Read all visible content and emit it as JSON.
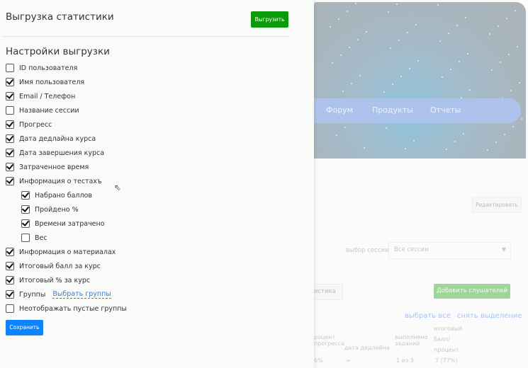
{
  "panel": {
    "title": "Выгрузка статистики",
    "export_label": "Выгрузить",
    "settings_title": "Настройки выгрузки",
    "save_label": "Сохранить",
    "options": [
      {
        "label": "ID пользователя",
        "checked": false,
        "indent": false
      },
      {
        "label": "Имя пользователя",
        "checked": true,
        "indent": false
      },
      {
        "label": "Email / Телефон",
        "checked": true,
        "indent": false
      },
      {
        "label": "Название сессии",
        "checked": false,
        "indent": false
      },
      {
        "label": "Прогресс",
        "checked": true,
        "indent": false
      },
      {
        "label": "Дата дедлайна курса",
        "checked": true,
        "indent": false
      },
      {
        "label": "Дата завершения курса",
        "checked": true,
        "indent": false
      },
      {
        "label": "Затраченное время",
        "checked": true,
        "indent": false
      },
      {
        "label": "Информация о тестахъ",
        "checked": true,
        "indent": false
      },
      {
        "label": "Набрано баллов",
        "checked": true,
        "indent": true
      },
      {
        "label": "Пройдено %",
        "checked": true,
        "indent": true
      },
      {
        "label": "Времени затрачено",
        "checked": true,
        "indent": true
      },
      {
        "label": "Вес",
        "checked": false,
        "indent": true
      },
      {
        "label": "Информация о материалах",
        "checked": true,
        "indent": false
      },
      {
        "label": "Итоговый балл за курс",
        "checked": true,
        "indent": false
      },
      {
        "label": "Итоговый % за курс",
        "checked": true,
        "indent": false
      },
      {
        "label": "Группы",
        "checked": true,
        "indent": false,
        "link": "Выбрать группы"
      },
      {
        "label": "Неотображать пустые группы",
        "checked": false,
        "indent": false
      }
    ]
  },
  "background": {
    "nav": [
      "Форум",
      "Продукты",
      "Отчеты"
    ],
    "edit_label": "Редактировать",
    "session_label": "выбор сессии",
    "session_value": "Все сессии",
    "stats_label": "тистика",
    "add_label": "Добавить слушателей",
    "select_all": "выбрать все",
    "deselect": "снять выделение",
    "headers": [
      "роцент прогресса",
      "дата дедлайна",
      "выполнено заданий",
      "итоговый балл/ процент"
    ],
    "row": [
      "6%",
      "∞",
      "1 из 3",
      "7 (77%)"
    ]
  }
}
